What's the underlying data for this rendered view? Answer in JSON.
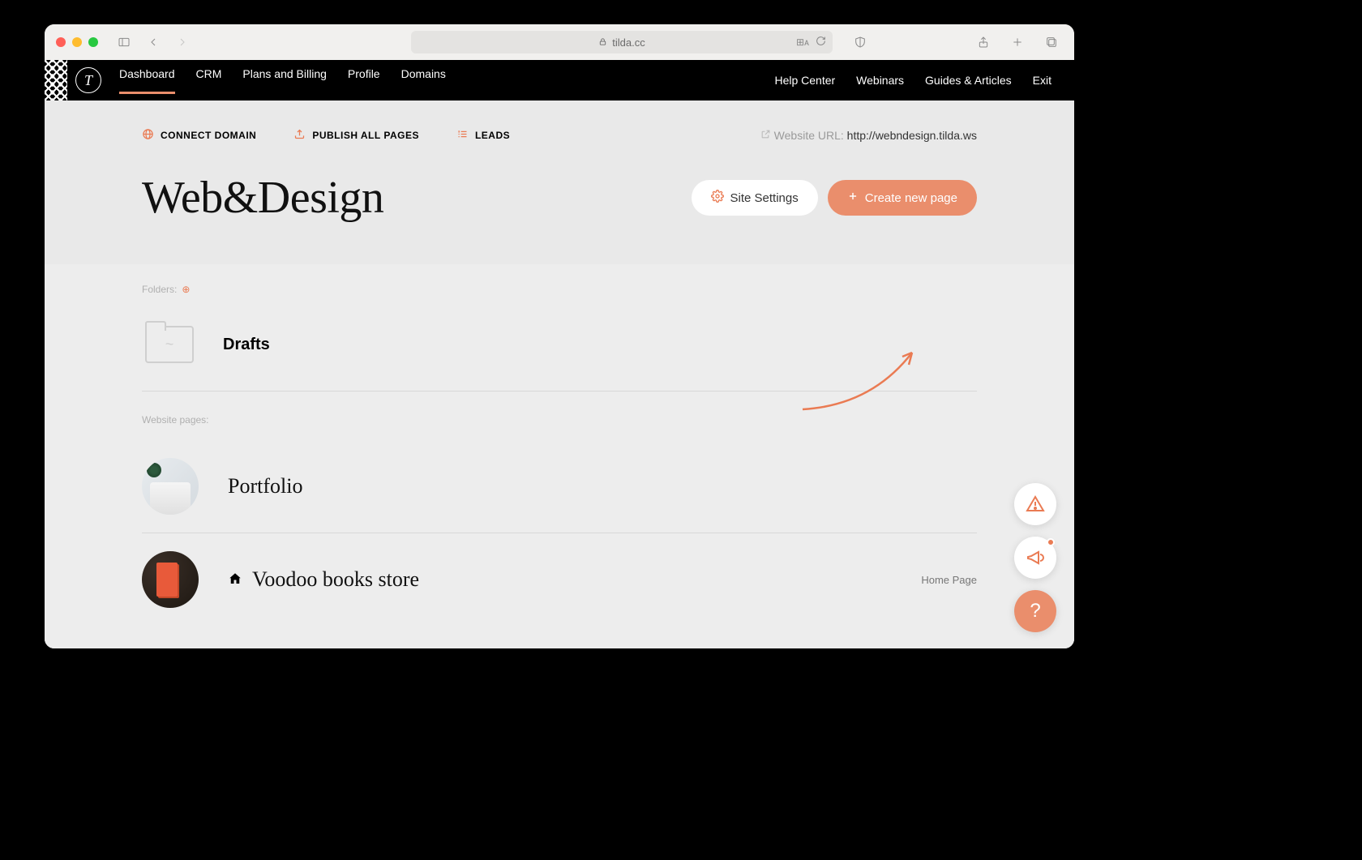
{
  "browser": {
    "url_host": "tilda.cc"
  },
  "header": {
    "nav": [
      "Dashboard",
      "CRM",
      "Plans and Billing",
      "Profile",
      "Domains"
    ],
    "nav_active_index": 0,
    "nav_right": [
      "Help Center",
      "Webinars",
      "Guides & Articles",
      "Exit"
    ]
  },
  "topbar": {
    "connect_domain": "CONNECT DOMAIN",
    "publish_all": "PUBLISH ALL PAGES",
    "leads": "LEADS",
    "url_label": "Website URL:",
    "url_value": "http://webndesign.tilda.ws"
  },
  "hero": {
    "site_title": "Web&Design",
    "site_settings": "Site Settings",
    "create_page": "Create new page"
  },
  "folders": {
    "label": "Folders:",
    "items": [
      {
        "name": "Drafts"
      }
    ]
  },
  "pages": {
    "label": "Website pages:",
    "items": [
      {
        "name": "Portfolio",
        "is_home": false,
        "tag": ""
      },
      {
        "name": "Voodoo books store",
        "is_home": true,
        "tag": "Home Page"
      }
    ]
  },
  "fab": {
    "help": "?"
  }
}
